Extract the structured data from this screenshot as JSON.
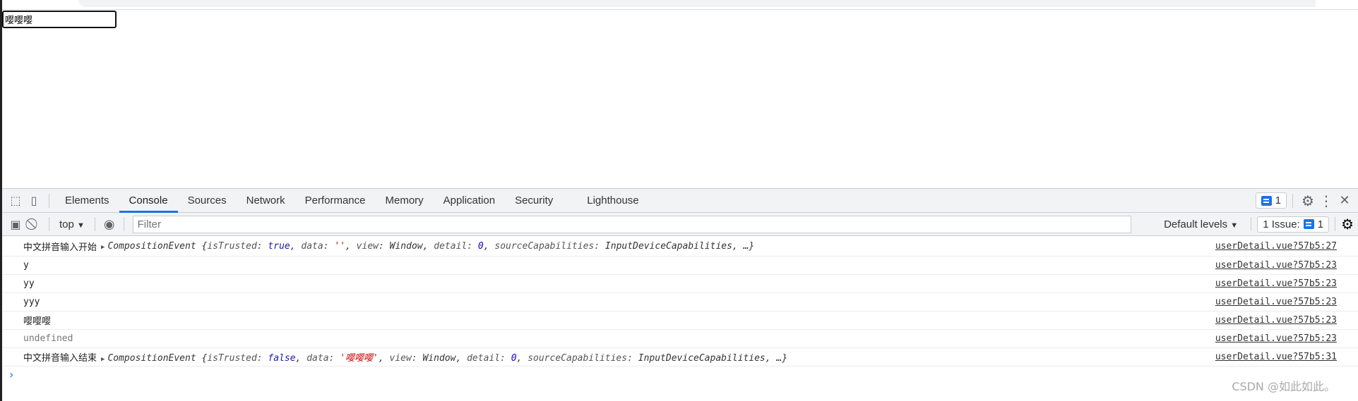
{
  "page": {
    "input_value": "嘤嘤嘤"
  },
  "devtools": {
    "tabs": [
      "Elements",
      "Console",
      "Sources",
      "Network",
      "Performance",
      "Memory",
      "Application",
      "Security",
      "Lighthouse"
    ],
    "active_tab": "Console",
    "issues_badge": "1",
    "toolbar": {
      "context": "top",
      "filter_placeholder": "Filter",
      "levels": "Default levels",
      "issues": "1 Issue:",
      "issues_count": "1"
    },
    "console": [
      {
        "text": "中文拼音输入开始",
        "obj": {
          "name": "CompositionEvent",
          "isTrusted": "true",
          "data": "''",
          "view": "Window",
          "detail": "0",
          "sourceCapabilities": "InputDeviceCapabilities"
        },
        "source": "userDetail.vue?57b5:27"
      },
      {
        "text": "y",
        "source": "userDetail.vue?57b5:23"
      },
      {
        "text": "yy",
        "source": "userDetail.vue?57b5:23"
      },
      {
        "text": "yyy",
        "source": "userDetail.vue?57b5:23"
      },
      {
        "text": "嘤嘤嘤",
        "source": "userDetail.vue?57b5:23"
      },
      {
        "text": "undefined",
        "source": "userDetail.vue?57b5:23"
      },
      {
        "text": "中文拼音输入结束",
        "obj": {
          "name": "CompositionEvent",
          "isTrusted": "false",
          "data": "'嘤嘤嘤'",
          "view": "Window",
          "detail": "0",
          "sourceCapabilities": "InputDeviceCapabilities"
        },
        "source": "userDetail.vue?57b5:31"
      }
    ]
  },
  "watermark": "CSDN @如此如此。"
}
